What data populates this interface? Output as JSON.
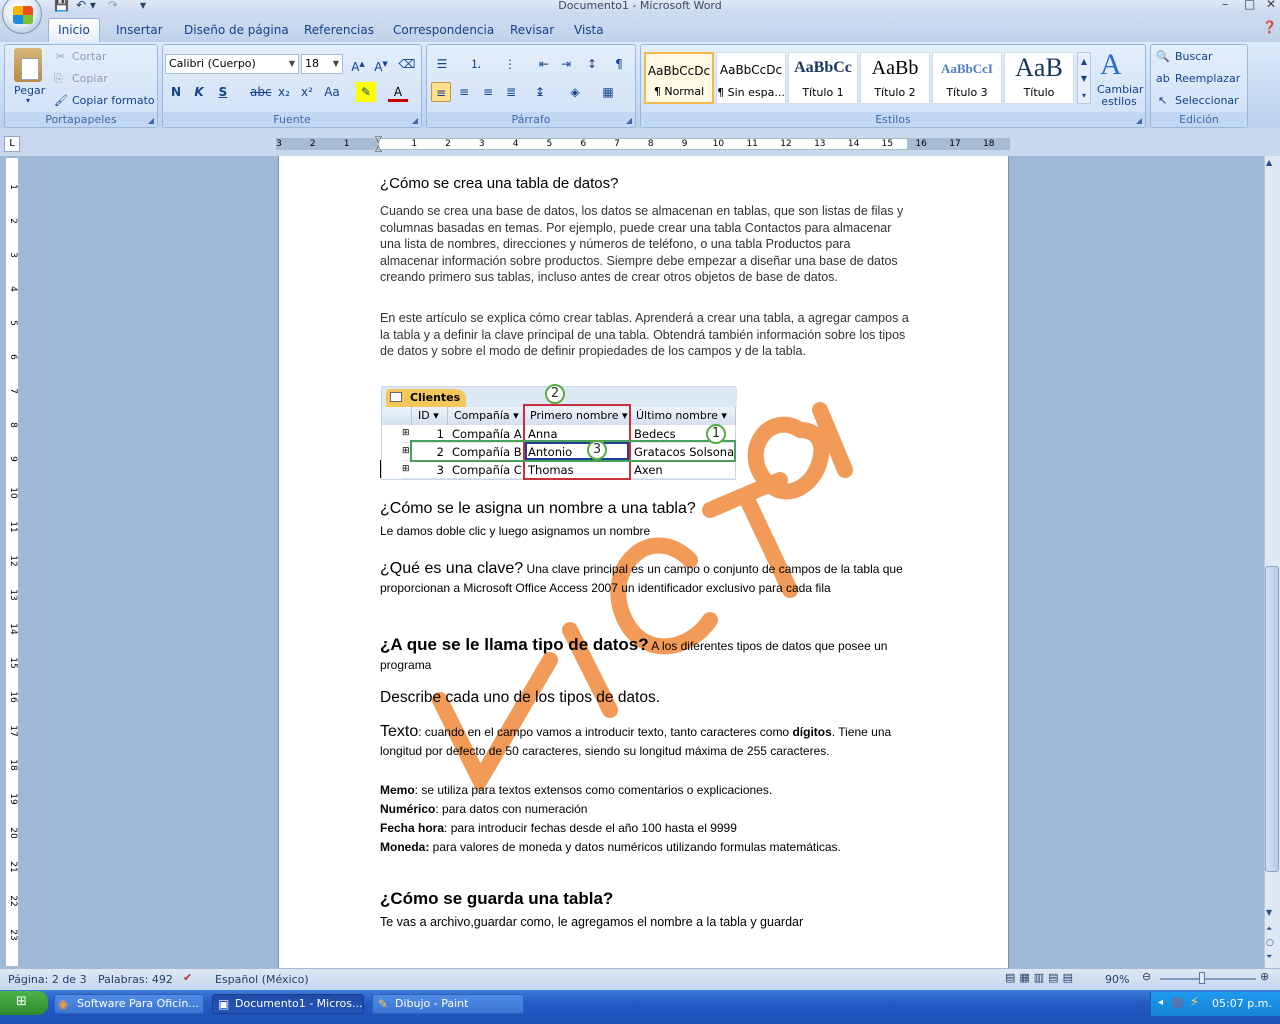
{
  "window": {
    "title": "Documento1 - Microsoft Word",
    "minimize": "–",
    "maximize": "□",
    "close": "✕"
  },
  "tabs": [
    "Inicio",
    "Insertar",
    "Diseño de página",
    "Referencias",
    "Correspondencia",
    "Revisar",
    "Vista"
  ],
  "ribbon": {
    "clipboard": {
      "label": "Portapapeles",
      "paste": "Pegar",
      "cut": "Cortar",
      "copy": "Copiar",
      "format_painter": "Copiar formato"
    },
    "font": {
      "label": "Fuente",
      "font_name": "Calibri (Cuerpo)",
      "font_size": "18"
    },
    "paragraph": {
      "label": "Párrafo"
    },
    "styles": {
      "label": "Estilos",
      "items": [
        {
          "preview": "AaBbCcDc",
          "name": "¶ Normal"
        },
        {
          "preview": "AaBbCcDc",
          "name": "¶ Sin espa..."
        },
        {
          "preview": "AaBbCc",
          "name": "Título 1"
        },
        {
          "preview": "AaBb",
          "name": "Título 2"
        },
        {
          "preview": "AaBbCcI",
          "name": "Título 3"
        },
        {
          "preview": "AaB",
          "name": "Título"
        }
      ],
      "change_styles": "Cambiar estilos"
    },
    "editing": {
      "label": "Edición",
      "find": "Buscar",
      "replace": "Reemplazar",
      "select": "Seleccionar"
    }
  },
  "document": {
    "heading1": "¿Cómo se crea una tabla de datos?",
    "para1": "Cuando se crea una base de datos, los datos se almacenan en tablas, que son listas de filas y columnas basadas en temas. Por ejemplo, puede crear una tabla Contactos para almacenar una lista de nombres, direcciones y números de teléfono, o una tabla Productos para almacenar información sobre productos. Siempre debe empezar a diseñar una base de datos creando primero sus tablas, incluso antes de crear otros objetos de base de datos.",
    "para2": "En este artículo se explica cómo crear tablas. Aprenderá a crear una tabla, a agregar campos a la tabla y a definir la clave principal de una tabla. Obtendrá también información sobre los tipos de datos y sobre el modo de definir propiedades de los campos y de la tabla.",
    "table_image": {
      "tab_name": "Clientes",
      "columns": [
        "ID",
        "Compañía",
        "Primero nombre",
        "Último nombre"
      ],
      "rows": [
        [
          "1",
          "Compañía A",
          "Anna",
          "Bedecs"
        ],
        [
          "2",
          "Compañía B",
          "Antonio",
          "Gratacos Solsona"
        ],
        [
          "3",
          "Compañía C",
          "Thomas",
          "Axen"
        ]
      ],
      "callouts": [
        "1",
        "2",
        "3"
      ]
    },
    "q2_heading": "¿Cómo se le asigna un nombre a una tabla?",
    "q2_answer": "Le damos doble clic y luego asignamos un nombre",
    "q3_heading": "¿Qué es una clave?",
    "q3_answer": " Una clave principal es un campo o conjunto de campos de la tabla que proporcionan a Microsoft Office Access 2007 un identificador exclusivo para cada fila",
    "q4_heading": "¿A que se le llama tipo de datos?",
    "q4_answer": " A los diferentes tipos de datos que posee un programa",
    "q5_heading": "Describe cada uno de los tipos de datos.",
    "types": {
      "texto_label": "Texto",
      "texto_desc": ": cuando en el campo vamos a introducir texto, tanto caracteres como ",
      "digitos": "dígitos",
      "texto_rest": ". Tiene una longitud por defecto de 50 caracteres, siendo su longitud máxima de 255 caracteres.",
      "memo_label": "Memo",
      "memo_desc": ": se utiliza para textos extensos como comentarios o explicaciones.",
      "numerico_label": "Numérico",
      "numerico_desc": ": para datos con numeración",
      "fecha_label": "Fecha hora",
      "fecha_desc": ": para introducir fechas desde el año 100 hasta el 9999",
      "moneda_label": "Moneda:",
      "moneda_desc": " para valores de moneda y datos numéricos utilizando formulas matemáticas."
    },
    "q6_heading": "¿Cómo se guarda una tabla?",
    "q6_answer": "Te vas a archivo,guardar como, le agregamos el nombre a la tabla y guardar",
    "watermark": "VICTOR 50/"
  },
  "statusbar": {
    "page": "Página: 2 de 3",
    "words": "Palabras: 492",
    "language": "Español (México)",
    "zoom": "90%"
  },
  "taskbar": {
    "items": [
      "Software Para Oficin...",
      "Documento1 - Micros...",
      "Dibujo - Paint"
    ],
    "clock": "05:07 p.m."
  },
  "colors": {
    "accent": "#15428b",
    "watermark": "#f08a3c"
  }
}
